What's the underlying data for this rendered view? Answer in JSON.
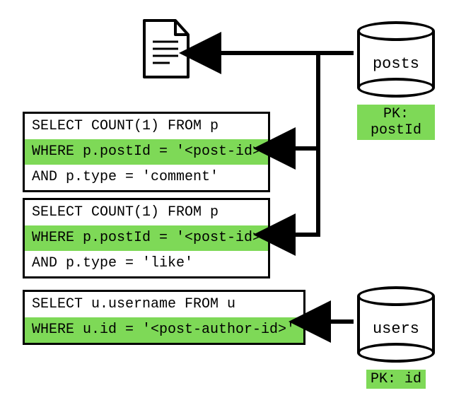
{
  "databases": {
    "posts": {
      "label": "posts",
      "pk": "PK: postId"
    },
    "users": {
      "label": "users",
      "pk": "PK: id"
    }
  },
  "queries": {
    "comments": {
      "l1": "SELECT COUNT(1) FROM p",
      "l2": "WHERE p.postId = '<post-id>'",
      "l3": "AND p.type = 'comment'"
    },
    "likes": {
      "l1": "SELECT COUNT(1) FROM p",
      "l2": "WHERE p.postId = '<post-id>'",
      "l3": "AND p.type = 'like'"
    },
    "author": {
      "l1": "SELECT u.username FROM u",
      "l2": "WHERE u.id = '<post-author-id>'"
    }
  }
}
